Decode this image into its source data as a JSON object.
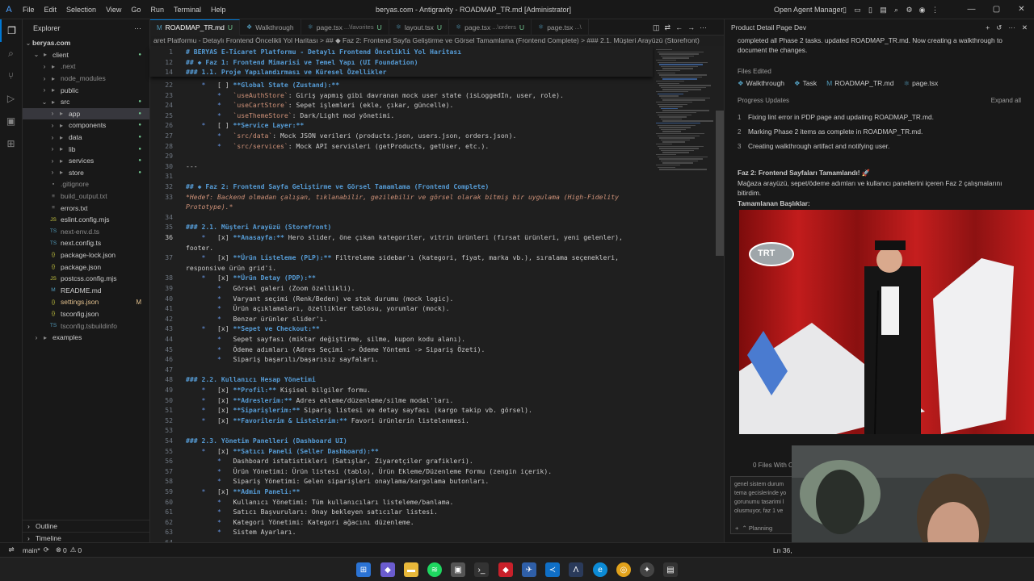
{
  "titlebar": {
    "menu": [
      "File",
      "Edit",
      "Selection",
      "View",
      "Go",
      "Run",
      "Terminal",
      "Help"
    ],
    "window_title": "beryas.com - Antigravity - ROADMAP_TR.md [Administrator]",
    "open_agent_manager": "Open Agent Manager"
  },
  "sidebar": {
    "title": "Explorer",
    "root": "beryas.com",
    "items": [
      {
        "label": "client",
        "indent": 1,
        "type": "folder-open",
        "badge": ""
      },
      {
        "label": ".next",
        "indent": 2,
        "type": "folder",
        "badge": ""
      },
      {
        "label": "node_modules",
        "indent": 2,
        "type": "folder",
        "badge": ""
      },
      {
        "label": "public",
        "indent": 2,
        "type": "folder",
        "badge": ""
      },
      {
        "label": "src",
        "indent": 2,
        "type": "folder-open",
        "badge": ""
      },
      {
        "label": "app",
        "indent": 3,
        "type": "folder",
        "badge": ""
      },
      {
        "label": "components",
        "indent": 3,
        "type": "folder",
        "badge": ""
      },
      {
        "label": "data",
        "indent": 3,
        "type": "folder",
        "badge": ""
      },
      {
        "label": "lib",
        "indent": 3,
        "type": "folder",
        "badge": ""
      },
      {
        "label": "services",
        "indent": 3,
        "type": "folder",
        "badge": ""
      },
      {
        "label": "store",
        "indent": 3,
        "type": "folder",
        "badge": ""
      },
      {
        "label": ".gitignore",
        "indent": 2,
        "type": "file",
        "badge": ""
      },
      {
        "label": "build_output.txt",
        "indent": 2,
        "type": "file",
        "badge": ""
      },
      {
        "label": "errors.txt",
        "indent": 2,
        "type": "file",
        "badge": ""
      },
      {
        "label": "eslint.config.mjs",
        "indent": 2,
        "type": "file",
        "badge": ""
      },
      {
        "label": "next-env.d.ts",
        "indent": 2,
        "type": "file",
        "badge": ""
      },
      {
        "label": "next.config.ts",
        "indent": 2,
        "type": "file",
        "badge": ""
      },
      {
        "label": "package-lock.json",
        "indent": 2,
        "type": "file",
        "badge": ""
      },
      {
        "label": "package.json",
        "indent": 2,
        "type": "file",
        "badge": ""
      },
      {
        "label": "postcss.config.mjs",
        "indent": 2,
        "type": "file",
        "badge": ""
      },
      {
        "label": "README.md",
        "indent": 2,
        "type": "file",
        "badge": ""
      },
      {
        "label": "settings.json",
        "indent": 2,
        "type": "file",
        "badge": "M"
      },
      {
        "label": "tsconfig.json",
        "indent": 2,
        "type": "file",
        "badge": ""
      },
      {
        "label": "tsconfig.tsbuildinfo",
        "indent": 2,
        "type": "file",
        "badge": ""
      },
      {
        "label": "examples",
        "indent": 1,
        "type": "folder",
        "badge": ""
      }
    ],
    "outline": "Outline",
    "timeline": "Timeline"
  },
  "tabs": [
    {
      "label": "ROADMAP_TR.md",
      "suffix": "",
      "mod": "U",
      "active": true
    },
    {
      "label": "Walkthrough",
      "suffix": "",
      "mod": "",
      "active": false
    },
    {
      "label": "page.tsx",
      "suffix": "...\\favorites",
      "mod": "U",
      "active": false
    },
    {
      "label": "layout.tsx",
      "suffix": "",
      "mod": "U",
      "active": false
    },
    {
      "label": "page.tsx",
      "suffix": "...\\orders",
      "mod": "U",
      "active": false
    },
    {
      "label": "page.tsx",
      "suffix": "...\\",
      "mod": "",
      "active": false
    }
  ],
  "breadcrumb": "aret Platformu - Detaylı Frontend Öncelikli Yol Haritası > ## ◆ Faz 2: Frontend Sayfa Geliştirme ve Görsel Tamamlama (Frontend Complete) > ### 2.1. Müşteri Arayüzü (Storefront)",
  "sticky_lines": [
    {
      "n": "1",
      "t": "# BERYAS E-Ticaret Platformu - Detaylı Frontend Öncelikli Yol Haritası",
      "s": "h"
    },
    {
      "n": "12",
      "t": "## ◆ Faz 1: Frontend Mimarisi ve Temel Yapı (UI Foundation)",
      "s": "h"
    },
    {
      "n": "14",
      "t": "### 1.1. Proje Yapılandırması ve Küresel Özellikler",
      "s": "h"
    }
  ],
  "lines": [
    {
      "n": "22",
      "t": "    *   [ ] **Global State (Zustand):**",
      "s": ""
    },
    {
      "n": "23",
      "t": "        *   `useAuthStore`: Giriş yapmış gibi davranan mock user state (isLoggedIn, user, role).",
      "s": ""
    },
    {
      "n": "24",
      "t": "        *   `useCartStore`: Sepet işlemleri (ekle, çıkar, güncelle).",
      "s": ""
    },
    {
      "n": "25",
      "t": "        *   `useThemeStore`: Dark/Light mod yönetimi.",
      "s": ""
    },
    {
      "n": "26",
      "t": "    *   [ ] **Service Layer:**",
      "s": ""
    },
    {
      "n": "27",
      "t": "        *   `src/data`: Mock JSON verileri (products.json, users.json, orders.json).",
      "s": ""
    },
    {
      "n": "28",
      "t": "        *   `src/services`: Mock API servisleri (getProducts, getUser, etc.).",
      "s": ""
    },
    {
      "n": "29",
      "t": "",
      "s": ""
    },
    {
      "n": "30",
      "t": "---",
      "s": ""
    },
    {
      "n": "31",
      "t": "",
      "s": ""
    },
    {
      "n": "32",
      "t": "## ◆ Faz 2: Frontend Sayfa Geliştirme ve Görsel Tamamlama (Frontend Complete)",
      "s": "h"
    },
    {
      "n": "33",
      "t": "*Hedef: Backend olmadan çalışan, tıklanabilir, gezilebilir ve görsel olarak bitmiş bir uygulama (High-Fidelity",
      "s": "i"
    },
    {
      "n": "",
      "t": "Prototype).*",
      "s": "i"
    },
    {
      "n": "34",
      "t": "",
      "s": ""
    },
    {
      "n": "35",
      "t": "### 2.1. Müşteri Arayüzü (Storefront)",
      "s": "h"
    },
    {
      "n": "36",
      "t": "    *   [x] **Anasayfa:** Hero slider, öne çıkan kategoriler, vitrin ürünleri (fırsat ürünleri, yeni gelenler),",
      "s": "",
      "cur": true
    },
    {
      "n": "",
      "t": "footer.",
      "s": ""
    },
    {
      "n": "37",
      "t": "    *   [x] **Ürün Listeleme (PLP):** Filtreleme sidebar'ı (kategori, fiyat, marka vb.), sıralama seçenekleri,",
      "s": ""
    },
    {
      "n": "",
      "t": "responsive ürün grid'i.",
      "s": ""
    },
    {
      "n": "38",
      "t": "    *   [x] **Ürün Detay (PDP):**",
      "s": ""
    },
    {
      "n": "39",
      "t": "        *   Görsel galeri (Zoom özellikli).",
      "s": ""
    },
    {
      "n": "40",
      "t": "        *   Varyant seçimi (Renk/Beden) ve stok durumu (mock logic).",
      "s": ""
    },
    {
      "n": "41",
      "t": "        *   Ürün açıklamaları, özellikler tablosu, yorumlar (mock).",
      "s": ""
    },
    {
      "n": "42",
      "t": "        *   Benzer ürünler slider'ı.",
      "s": ""
    },
    {
      "n": "43",
      "t": "    *   [x] **Sepet ve Checkout:**",
      "s": ""
    },
    {
      "n": "44",
      "t": "        *   Sepet sayfası (miktar değiştirme, silme, kupon kodu alanı).",
      "s": ""
    },
    {
      "n": "45",
      "t": "        *   Ödeme adımları (Adres Seçimi -> Ödeme Yöntemi -> Sipariş Özeti).",
      "s": ""
    },
    {
      "n": "46",
      "t": "        *   Sipariş başarılı/başarısız sayfaları.",
      "s": ""
    },
    {
      "n": "47",
      "t": "",
      "s": ""
    },
    {
      "n": "48",
      "t": "### 2.2. Kullanıcı Hesap Yönetimi",
      "s": "h"
    },
    {
      "n": "49",
      "t": "    *   [x] **Profil:** Kişisel bilgiler formu.",
      "s": ""
    },
    {
      "n": "50",
      "t": "    *   [x] **Adreslerim:** Adres ekleme/düzenleme/silme modal'ları.",
      "s": ""
    },
    {
      "n": "51",
      "t": "    *   [x] **Siparişlerim:** Sipariş listesi ve detay sayfası (kargo takip vb. görsel).",
      "s": ""
    },
    {
      "n": "52",
      "t": "    *   [x] **Favorilerim & Listelerim:** Favori ürünlerin listelenmesi.",
      "s": ""
    },
    {
      "n": "53",
      "t": "",
      "s": ""
    },
    {
      "n": "54",
      "t": "### 2.3. Yönetim Panelleri (Dashboard UI)",
      "s": "h"
    },
    {
      "n": "55",
      "t": "    *   [x] **Satıcı Paneli (Seller Dashboard):**",
      "s": ""
    },
    {
      "n": "56",
      "t": "        *   Dashboard istatistikleri (Satışlar, Ziyaretçiler grafikleri).",
      "s": ""
    },
    {
      "n": "57",
      "t": "        *   Ürün Yönetimi: Ürün listesi (tablo), Ürün Ekleme/Düzenleme Formu (zengin içerik).",
      "s": ""
    },
    {
      "n": "58",
      "t": "        *   Sipariş Yönetimi: Gelen siparişleri onaylama/kargolama butonları.",
      "s": ""
    },
    {
      "n": "59",
      "t": "    *   [x] **Admin Paneli:**",
      "s": ""
    },
    {
      "n": "60",
      "t": "        *   Kullanıcı Yönetimi: Tüm kullanıcıları listeleme/banlama.",
      "s": ""
    },
    {
      "n": "61",
      "t": "        *   Satıcı Başvuruları: Onay bekleyen satıcılar listesi.",
      "s": ""
    },
    {
      "n": "62",
      "t": "        *   Kategori Yönetimi: Kategori ağacını düzenleme.",
      "s": ""
    },
    {
      "n": "63",
      "t": "        *   Sistem Ayarları.",
      "s": ""
    },
    {
      "n": "64",
      "t": "",
      "s": ""
    }
  ],
  "agent": {
    "title": "Product Detail Page Dev",
    "intro": "completed all Phase 2 tasks. updated ROADMAP_TR.md. Now creating a walkthrough to document the changes.",
    "files_edited_label": "Files Edited",
    "files": [
      "Walkthrough",
      "Task",
      "ROADMAP_TR.md",
      "page.tsx"
    ],
    "progress_label": "Progress Updates",
    "expand_all": "Expand all",
    "steps": [
      {
        "n": "1",
        "t": "Fixing lint error in PDP page and updating ROADMAP_TR.md."
      },
      {
        "n": "2",
        "t": "Marking Phase 2 items as complete in ROADMAP_TR.md."
      },
      {
        "n": "3",
        "t": "Creating walkthrough artifact and notifying user."
      }
    ],
    "summary_title": "Faz 2: Frontend Sayfaları Tamamlandı! 🚀",
    "summary_body": "Mağaza arayüzü, sepet/ödeme adımları ve kullanıcı panellerini içeren Faz 2 çalışmalarını bitirdim.",
    "summary_sub": "Tamamlanan Başlıklar:",
    "files_with": "0 Files With C",
    "chat_text": "genel sistem durum tema gecislerinde yo gorunumu tasarimi l olusmuyor, faz 1 ve",
    "planning": "Planning"
  },
  "video": {
    "channel_logo": "TRT"
  },
  "statusbar": {
    "branch": "main*",
    "problems": "0",
    "warnings": "0",
    "position": "Ln 36,"
  },
  "colors": {
    "accent": "#0078d4",
    "editor_bg": "#1f1f1f",
    "heading": "#569cd6",
    "modified": "#73c991"
  }
}
